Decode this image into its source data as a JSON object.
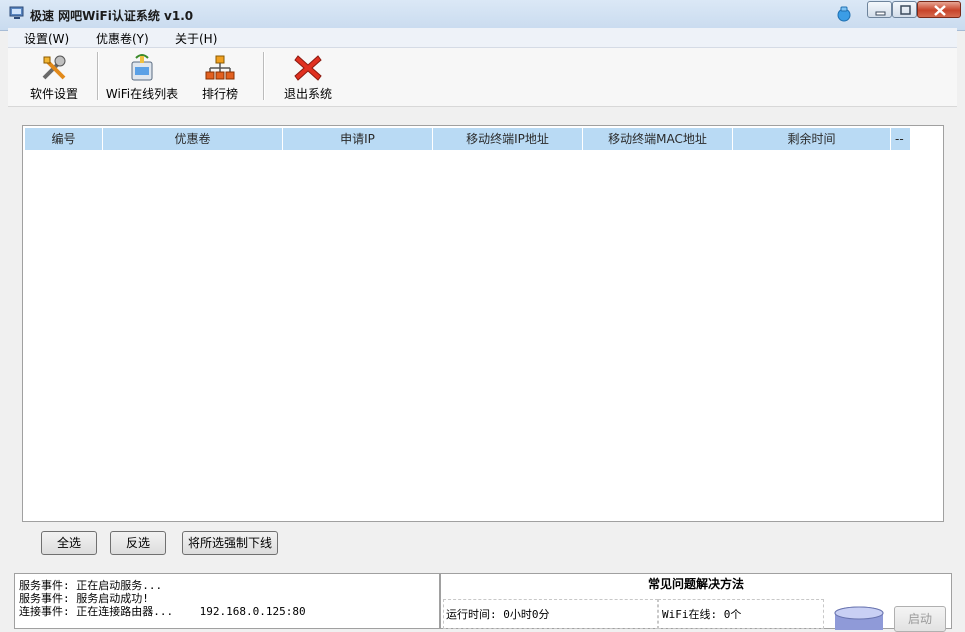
{
  "window": {
    "title": "极速 网吧WiFi认证系统 v1.0",
    "accent": "#b9daf4"
  },
  "menu": [
    {
      "label": "设置(W)"
    },
    {
      "label": "优惠卷(Y)"
    },
    {
      "label": "关于(H)"
    }
  ],
  "toolbar": [
    {
      "label": "软件设置",
      "icon": "tools-icon"
    },
    {
      "label": "WiFi在线列表",
      "icon": "router-icon"
    },
    {
      "label": "排行榜",
      "icon": "hierarchy-icon"
    },
    {
      "label": "退出系统",
      "icon": "exit-x-icon"
    }
  ],
  "table": {
    "columns": [
      "编号",
      "优惠卷",
      "申请IP",
      "移动终端IP地址",
      "移动终端MAC地址",
      "剩余时间",
      "--"
    ],
    "rows": []
  },
  "actions": {
    "select_all": "全选",
    "invert": "反选",
    "force_offline": "将所选强制下线"
  },
  "log": [
    "服务事件: 正在启动服务...",
    "服务事件: 服务启动成功!",
    "连接事件: 正在连接路由器...    192.168.0.125:80"
  ],
  "info": {
    "title": "常见问题解决方法",
    "runtime": "运行时间: 0小时0分",
    "online": "WiFi在线: 0个",
    "start_label": "启动"
  }
}
